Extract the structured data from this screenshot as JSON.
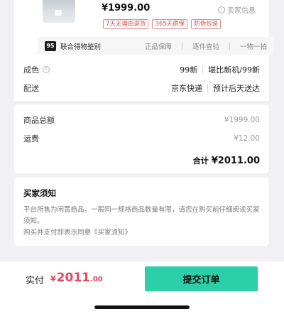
{
  "product": {
    "price": "¥1999.00",
    "seller_info": "卖家信息",
    "tags": [
      "7天无理由退货",
      "365天质保",
      "防伪包装"
    ]
  },
  "auth": {
    "logo": "95",
    "name": "联合得物鉴别",
    "items": [
      "正品保障",
      "逐件查验",
      "一物一拍"
    ]
  },
  "attributes": [
    {
      "label": "成色",
      "values": [
        "99新",
        "堪比新机/99新"
      ]
    },
    {
      "label": "配送",
      "values": [
        "京东快递",
        "预计后天送达"
      ]
    }
  ],
  "summary": {
    "goods_total_label": "商品总额",
    "goods_total_value": "¥1999.00",
    "shipping_label": "运费",
    "shipping_value": "¥12.00",
    "total_label": "合计",
    "total_value": "¥2011.00"
  },
  "notice": {
    "title": "买家须知",
    "line1": "平台所售为闲置商品，一般同一规格商品数量有限，请您在购买前仔细阅读买家须知。",
    "line2": "购买并支付即表示同意《买家须知》"
  },
  "footer": {
    "pay_label": "实付",
    "pay_currency": "¥",
    "pay_int": "2011",
    "pay_dec": ".00",
    "submit_label": "提交订单"
  },
  "colors": {
    "accent": "#2ccfa7",
    "price_red": "#e9475b",
    "tag_red": "#d64a4a",
    "background": "#f1f1f3"
  }
}
